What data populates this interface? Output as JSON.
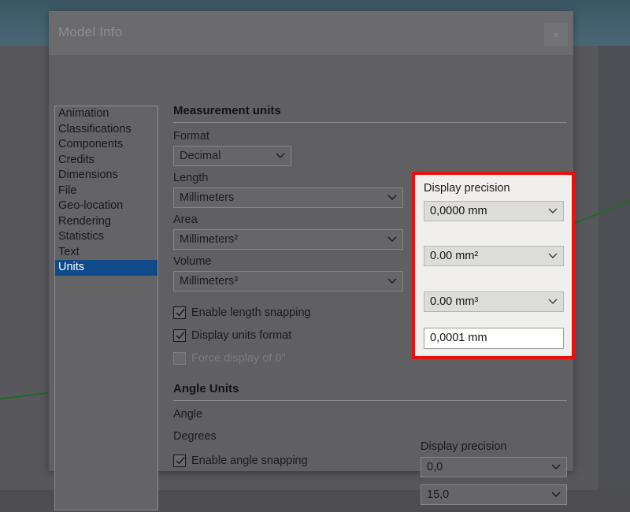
{
  "background": {
    "sky_color": "#44606e",
    "ground_color": "#58585c",
    "axis_color": "#1f6b25"
  },
  "dialog": {
    "title": "Model Info",
    "close_label": "×",
    "bg_color": "#606062",
    "titlebar_color": "#6b6b6d"
  },
  "sidebar": {
    "items": [
      {
        "label": "Animation",
        "selected": false
      },
      {
        "label": "Classifications",
        "selected": false
      },
      {
        "label": "Components",
        "selected": false
      },
      {
        "label": "Credits",
        "selected": false
      },
      {
        "label": "Dimensions",
        "selected": false
      },
      {
        "label": "File",
        "selected": false
      },
      {
        "label": "Geo-location",
        "selected": false
      },
      {
        "label": "Rendering",
        "selected": false
      },
      {
        "label": "Statistics",
        "selected": false
      },
      {
        "label": "Text",
        "selected": false
      },
      {
        "label": "Units",
        "selected": true
      }
    ],
    "selected_bg": "#0f4a8a"
  },
  "measurement": {
    "section_title": "Measurement units",
    "format_label": "Format",
    "format_value": "Decimal",
    "length_label": "Length",
    "length_value": "Millimeters",
    "area_label": "Area",
    "area_value": "Millimeters²",
    "volume_label": "Volume",
    "volume_value": "Millimeters³",
    "enable_length_snapping_label": "Enable length snapping",
    "enable_length_snapping_checked": true,
    "display_units_format_label": "Display units format",
    "display_units_format_checked": true,
    "force_display_label": "Force display of 0\"",
    "force_display_checked": false,
    "force_display_disabled": true
  },
  "precision_highlight": {
    "label": "Display precision",
    "length_precision": "0,0000 mm",
    "area_precision": "0.00 mm²",
    "volume_precision": "0.00 mm³",
    "snapping_length": "0,0001 mm",
    "highlight_color": "#e8100f"
  },
  "angle": {
    "section_title": "Angle Units",
    "angle_label": "Angle",
    "degrees_label": "Degrees",
    "enable_angle_snapping_label": "Enable angle snapping",
    "enable_angle_snapping_checked": true,
    "precision_label": "Display precision",
    "degrees_precision": "0,0",
    "snapping_angle": "15,0"
  }
}
